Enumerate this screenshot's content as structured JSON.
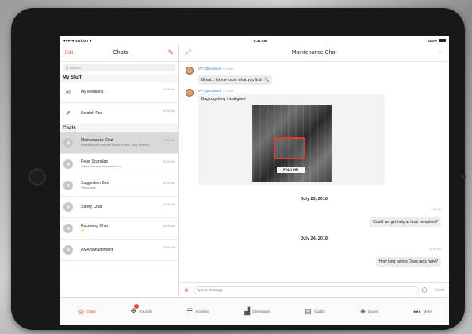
{
  "status": {
    "carrier": "●●●●● Verizon ▼",
    "time": "9:41 AM",
    "battery": "100%"
  },
  "left": {
    "edit": "Edit",
    "title": "Chats",
    "search_placeholder": "Q Search",
    "section_my_stuff": "My Stuff",
    "section_chats": "Chats",
    "my_stuff": [
      {
        "title": "My Mentions",
        "time": "10:05 AM"
      },
      {
        "title": "Scratch Pad",
        "time": "10:05 AM"
      }
    ],
    "chats": [
      {
        "title": "Maintenance Chat",
        "sub": "Everything fine! Request comes in here. Okay, let's fix it",
        "time": "10:05 AM"
      },
      {
        "title": "Peter Scandige",
        "sub": "Joined chat and Snapshot Add a...",
        "time": "10:05 AM"
      },
      {
        "title": "Suggestion Box",
        "sub": "This is done",
        "time": "10:05 AM"
      },
      {
        "title": "Safety Chat",
        "sub": "",
        "time": "10:05 AM"
      },
      {
        "title": "Receiving Chat",
        "sub": "",
        "time": "10:05 AM",
        "star": "★"
      },
      {
        "title": "AMAmanagement",
        "sub": "",
        "time": "10:05 AM"
      }
    ]
  },
  "right": {
    "title": "Maintenance Chat",
    "more": "···",
    "messages": [
      {
        "sender": "VP Operations",
        "time": "9:19 AM",
        "text": "Great... let me know what you find",
        "emoji": "🔍"
      },
      {
        "sender": "VP Operations",
        "time": "9:20 AM",
        "caption": "Bag is getting misaligned",
        "photo_tag": "FOLD PIN"
      }
    ],
    "date1": "July 23, 2018",
    "out1": {
      "time": "9:48 AM",
      "text": "Could we get help at front reception?"
    },
    "date2": "July 24, 2018",
    "out2": {
      "time": "10:05 AM",
      "text": "How long before Dave gets here?"
    },
    "input_placeholder": "Type a Message",
    "send": "Send"
  },
  "tabs": [
    {
      "label": "Chats",
      "icon": "chat-icon",
      "glyph": "◎"
    },
    {
      "label": "Rounds",
      "icon": "rounds-icon",
      "glyph": "✤"
    },
    {
      "label": "Activities",
      "icon": "activities-icon",
      "glyph": "☰"
    },
    {
      "label": "Operations",
      "icon": "operations-icon",
      "glyph": "▟"
    },
    {
      "label": "Quality",
      "icon": "quality-icon",
      "glyph": "▤"
    },
    {
      "label": "Issues",
      "icon": "issues-icon",
      "glyph": "◈"
    },
    {
      "label": "More",
      "icon": "more-icon",
      "glyph": "•••"
    }
  ],
  "colors": {
    "accent": "#e5533a",
    "link": "#3a7bd5",
    "bubble": "#ececec"
  }
}
